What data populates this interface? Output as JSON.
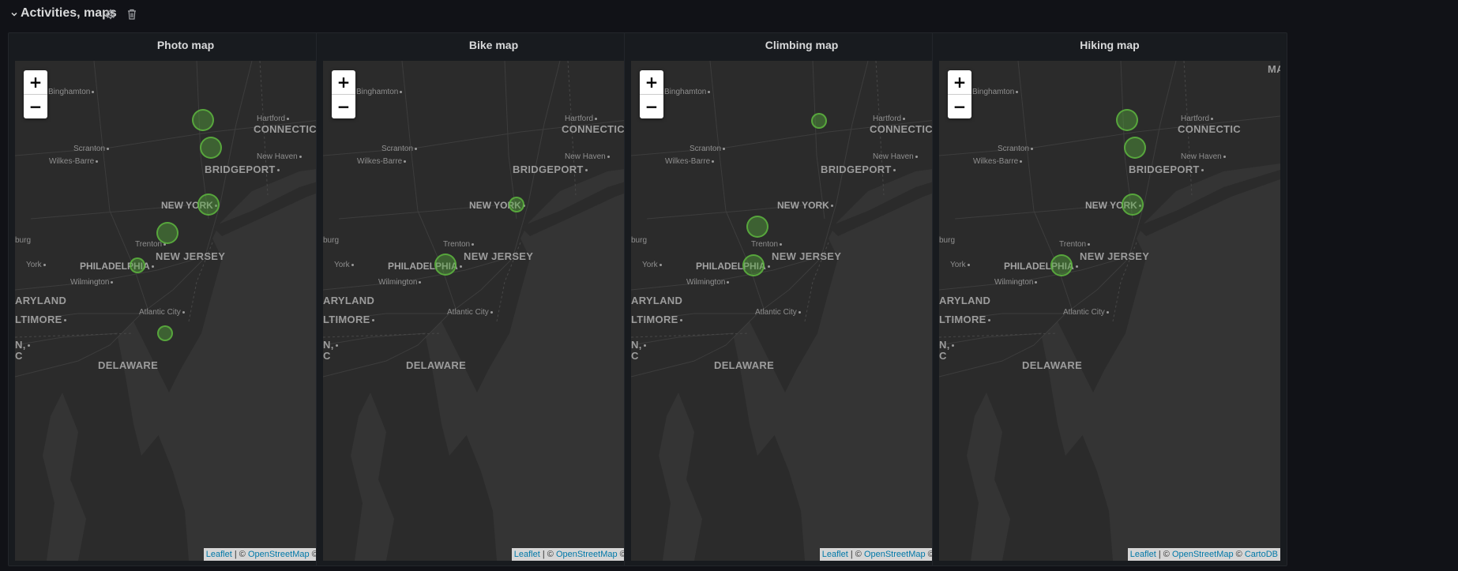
{
  "row": {
    "title": "Activities, maps",
    "icons": [
      "chevron-down-icon",
      "gear-icon",
      "trash-icon"
    ]
  },
  "colors": {
    "background": "#111217",
    "panel": "#181b1f",
    "map_land": "#2c2c2c",
    "map_water": "#343434",
    "marker_fill": "#54a53b",
    "attribution_link": "#0078a8"
  },
  "map_labels": {
    "binghamton": "Binghamton",
    "hartford": "Hartford",
    "connecticut": "CONNECTIC",
    "ma": "MA",
    "scranton": "Scranton",
    "new_haven": "New Haven",
    "wilkes_barre": "Wilkes-Barre",
    "bridgeport": "BRIDGEPORT",
    "new_york": "NEW YORK",
    "trenton": "Trenton",
    "burg": "burg",
    "new_jersey": "NEW JERSEY",
    "york": "York",
    "philadelphia": "PHILADELPHIA",
    "wilmington": "Wilmington",
    "aryland": "ARYLAND",
    "atlantic_city": "Atlantic City",
    "ltimore": "LTIMORE",
    "n": "N,",
    "c": "C",
    "delaware": "DELAWARE"
  },
  "zoom": {
    "in": "+",
    "out": "−"
  },
  "attribution": {
    "leaflet": "Leaflet",
    "sep1": " | © ",
    "osm": "OpenStreetMap",
    "sep2": " © ",
    "carto": "CartoDB"
  },
  "panels": [
    {
      "title": "Photo map"
    },
    {
      "title": "Bike map"
    },
    {
      "title": "Climbing map"
    },
    {
      "title": "Hiking map"
    }
  ]
}
